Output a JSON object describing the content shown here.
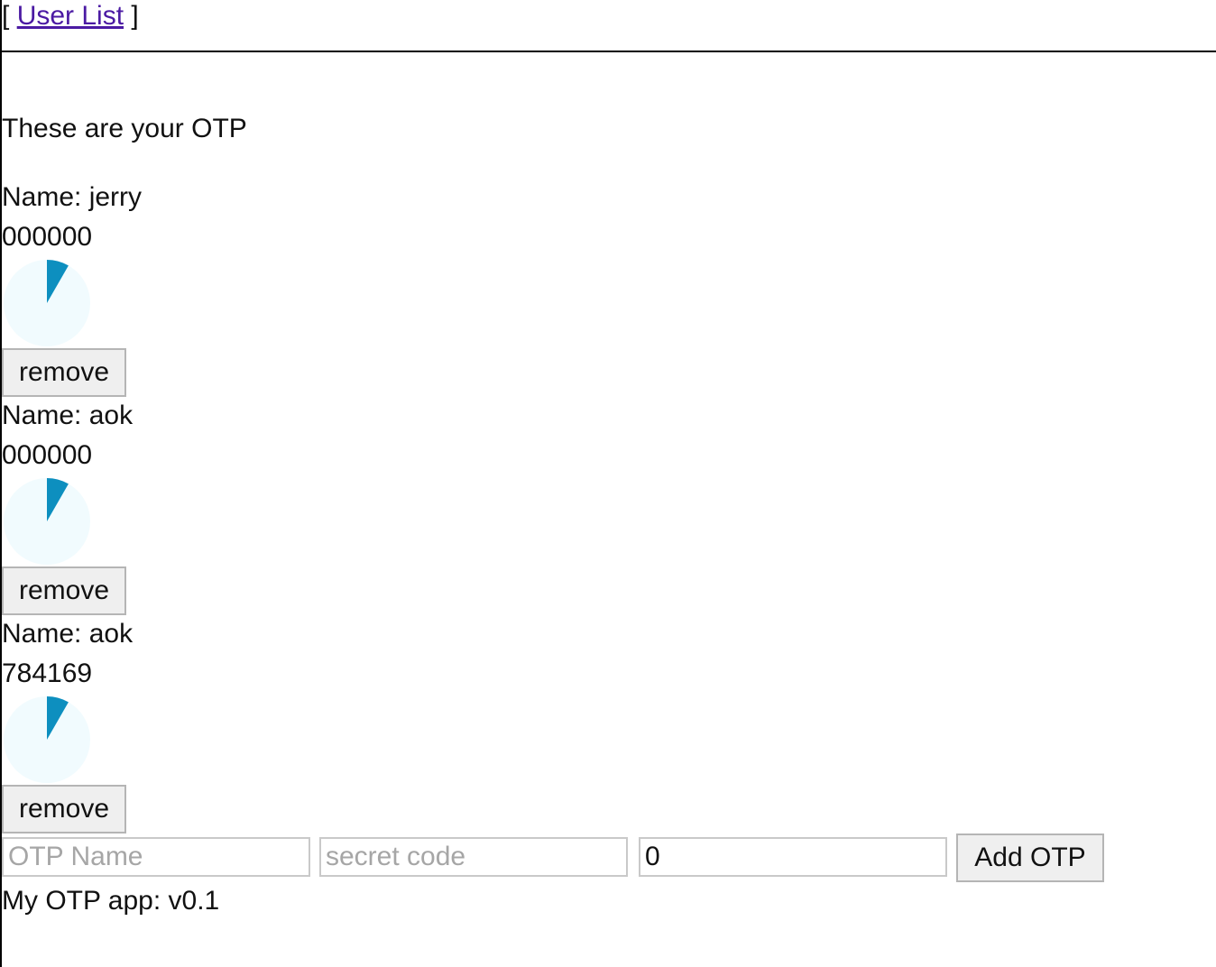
{
  "nav": {
    "open_bracket": "[",
    "link_label": "User List",
    "close_bracket": "]"
  },
  "intro_text": "These are your OTP",
  "otps": [
    {
      "name_label": "Name: jerry",
      "code": "000000",
      "remove_label": "remove",
      "time_elapsed_fraction": 0.083
    },
    {
      "name_label": "Name: aok",
      "code": "000000",
      "remove_label": "remove",
      "time_elapsed_fraction": 0.083
    },
    {
      "name_label": "Name: aok",
      "code": "784169",
      "remove_label": "remove",
      "time_elapsed_fraction": 0.083
    }
  ],
  "add_form": {
    "name_placeholder": "OTP Name",
    "secret_placeholder": "secret code",
    "number_value": "0",
    "add_label": "Add OTP"
  },
  "footer_text": "My OTP app: v0.1",
  "colors": {
    "timer_fill": "#0d8fbf",
    "timer_track": "#f1fbfe",
    "link": "#4b1aa3"
  }
}
